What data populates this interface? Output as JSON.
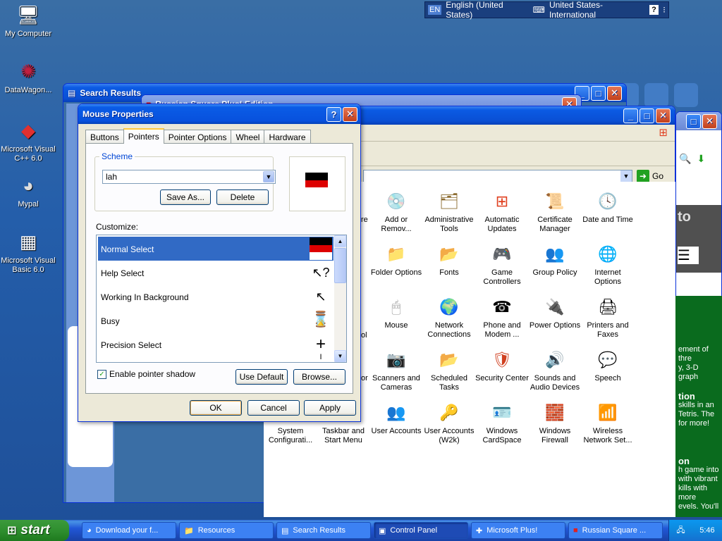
{
  "desktop": {
    "icons": [
      {
        "label": "My Computer",
        "icon": "computer-icon"
      },
      {
        "label": "DataWagon...",
        "icon": "shortcut-icon"
      },
      {
        "label": "Microsoft Visual C++ 6.0",
        "icon": "visual-cpp-icon"
      },
      {
        "label": "Mypal",
        "icon": "raccoon-icon"
      },
      {
        "label": "Microsoft Visual Basic 6.0",
        "icon": "visual-basic-icon"
      }
    ]
  },
  "language_bar": {
    "lang_code": "EN",
    "language": "English (United States)",
    "keyboard": "United States-International",
    "help": "?"
  },
  "windows": {
    "search_results_title": "Search Results",
    "russian_square_title": "Russian Square Plus! Edition"
  },
  "control_panel": {
    "address": {
      "go_label": "Go"
    },
    "items": [
      {
        "label": "Add or Remov...",
        "icon": "add-remove-icon"
      },
      {
        "label": "Administrative Tools",
        "icon": "admin-tools-icon"
      },
      {
        "label": "Automatic Updates",
        "icon": "windows-update-icon"
      },
      {
        "label": "Certificate Manager",
        "icon": "certificate-icon"
      },
      {
        "label": "Date and Time",
        "icon": "clock-icon"
      },
      {
        "label": "Folder Options",
        "icon": "folder-options-icon"
      },
      {
        "label": "Fonts",
        "icon": "fonts-folder-icon"
      },
      {
        "label": "Game Controllers",
        "icon": "gamepad-icon"
      },
      {
        "label": "Group Policy",
        "icon": "group-policy-icon"
      },
      {
        "label": "Internet Options",
        "icon": "globe-icon"
      },
      {
        "label": "Mouse",
        "icon": "mouse-icon"
      },
      {
        "label": "Network Connections",
        "icon": "network-icon"
      },
      {
        "label": "Phone and Modem ...",
        "icon": "phone-icon"
      },
      {
        "label": "Power Options",
        "icon": "power-icon"
      },
      {
        "label": "Printers and Faxes",
        "icon": "printer-icon"
      },
      {
        "label": "Scanners and Cameras",
        "icon": "scanner-icon"
      },
      {
        "label": "Scheduled Tasks",
        "icon": "scheduled-tasks-icon"
      },
      {
        "label": "Security Center",
        "icon": "shield-icon"
      },
      {
        "label": "Sounds and Audio Devices",
        "icon": "speaker-icon"
      },
      {
        "label": "Speech",
        "icon": "speech-icon"
      },
      {
        "label": "System Configurati...",
        "icon": "system-icon"
      },
      {
        "label": "Taskbar and Start Menu",
        "icon": "taskbar-icon"
      },
      {
        "label": "User Accounts",
        "icon": "users-icon"
      },
      {
        "label": "User Accounts (W2k)",
        "icon": "user-key-icon"
      },
      {
        "label": "Windows CardSpace",
        "icon": "cardspace-icon"
      },
      {
        "label": "Windows Firewall",
        "icon": "firewall-icon"
      },
      {
        "label": "Wireless Network Set...",
        "icon": "wireless-icon"
      }
    ],
    "partial_labels": [
      "re",
      "ol",
      "or"
    ]
  },
  "web_panel": {
    "fragment_to": "to",
    "lines": [
      "ement of thre",
      "y, 3-D graph",
      "tion",
      "skills in an",
      "Tetris. The",
      "for more!",
      "on",
      "h game into",
      "with vibrant",
      "kills with more",
      "evels. You'll"
    ]
  },
  "dialog": {
    "title": "Mouse Properties",
    "help_btn": "?",
    "close_btn": "✕",
    "tabs": [
      "Buttons",
      "Pointers",
      "Pointer Options",
      "Wheel",
      "Hardware"
    ],
    "scheme_label": "Scheme",
    "scheme_value": "lah",
    "save_as": "Save As...",
    "delete": "Delete",
    "customize_label": "Customize:",
    "pointers": [
      {
        "label": "Normal Select",
        "glyph": ""
      },
      {
        "label": "Help Select",
        "glyph": "↖?"
      },
      {
        "label": "Working In Background",
        "glyph": "↖⌛"
      },
      {
        "label": "Busy",
        "glyph": "⌛"
      },
      {
        "label": "Precision Select",
        "glyph": "+"
      },
      {
        "label": "",
        "glyph": "I"
      }
    ],
    "shadow_label": "Enable pointer shadow",
    "shadow_checked": "✓",
    "use_default": "Use Default",
    "browse": "Browse...",
    "ok": "OK",
    "cancel": "Cancel",
    "apply": "Apply"
  },
  "taskbar": {
    "start": "start",
    "tasks": [
      {
        "label": "Download your f...",
        "icon": "browser-icon"
      },
      {
        "label": "Resources",
        "icon": "folder-icon"
      },
      {
        "label": "Search Results",
        "icon": "search-window-icon"
      },
      {
        "label": "Control Panel",
        "icon": "control-panel-icon"
      },
      {
        "label": "Microsoft Plus!",
        "icon": "plus-icon"
      },
      {
        "label": "Russian Square ...",
        "icon": "game-icon"
      }
    ],
    "clock": "5:46"
  },
  "colors": {
    "xp_blue": "#0a5ce6",
    "selection": "#316ac5",
    "start_green": "#2f8f2f"
  }
}
